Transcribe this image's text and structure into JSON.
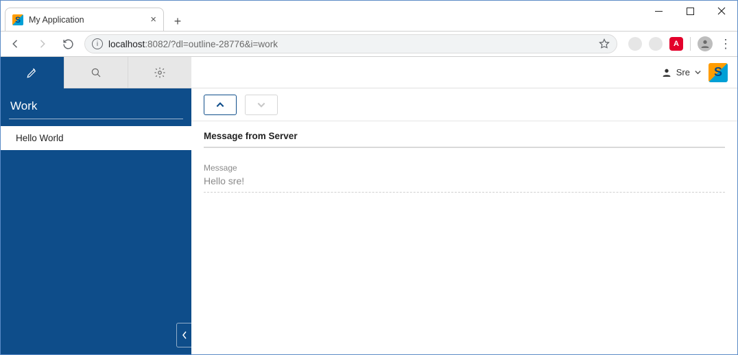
{
  "window": {
    "tab_title": "My Application"
  },
  "address": {
    "host": "localhost",
    "rest": ":8082/?dl=outline-28776&i=work"
  },
  "sidebar": {
    "section_title": "Work",
    "items": [
      {
        "label": "Hello World"
      }
    ]
  },
  "topbar": {
    "username": "Sre"
  },
  "card": {
    "title": "Message from Server",
    "field_label": "Message",
    "field_value": "Hello sre!"
  }
}
